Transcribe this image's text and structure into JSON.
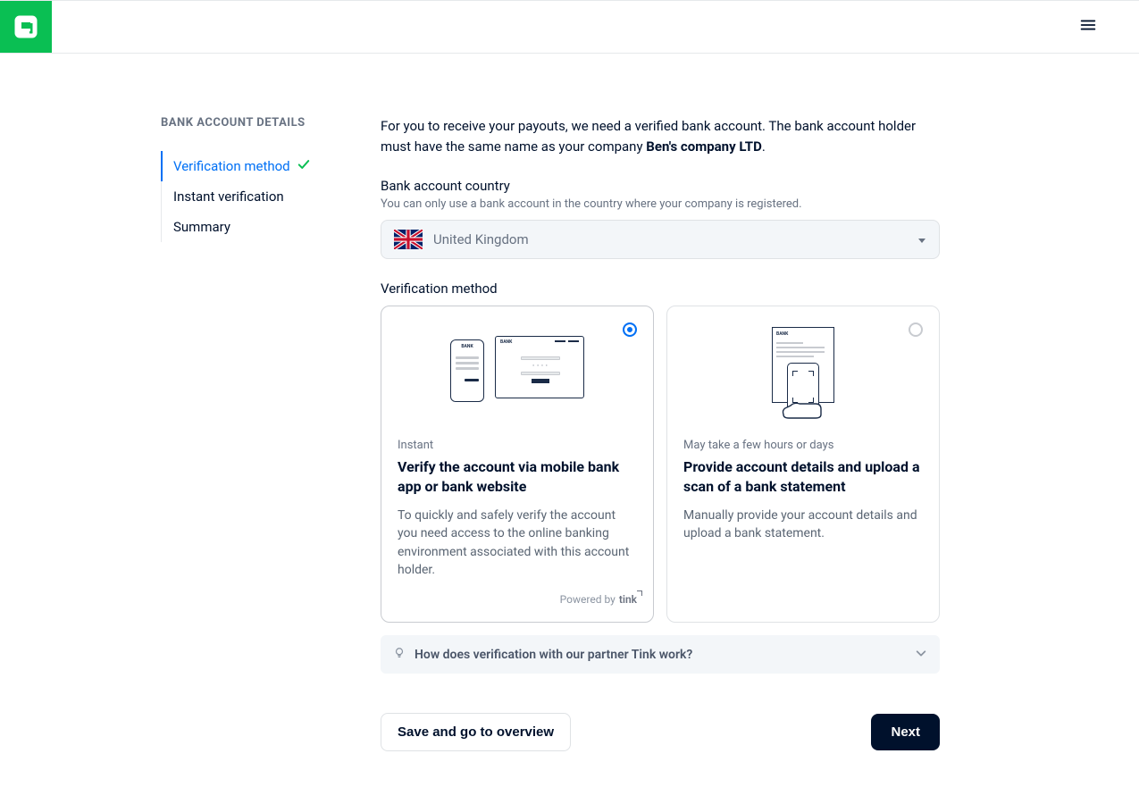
{
  "sidebar": {
    "title": "BANK ACCOUNT DETAILS",
    "items": [
      {
        "label": "Verification method",
        "active": true,
        "completed": true
      },
      {
        "label": "Instant verification",
        "active": false,
        "completed": false
      },
      {
        "label": "Summary",
        "active": false,
        "completed": false
      }
    ]
  },
  "intro": {
    "text_before": "For you to receive your payouts, we need a verified bank account. The bank account holder must have the same name as your company ",
    "company_name": "Ben's company LTD",
    "text_after": "."
  },
  "country": {
    "label": "Bank account country",
    "hint": "You can only use a bank account in the country where your company is registered.",
    "selected": "United Kingdom"
  },
  "method": {
    "label": "Verification method",
    "options": [
      {
        "tag": "Instant",
        "title": "Verify the account via mobile bank app or bank website",
        "desc": "To quickly and safely verify the account you need access to the online banking environment associated with this account holder.",
        "powered_by_label": "Powered by",
        "powered_by_name": "tink",
        "selected": true
      },
      {
        "tag": "May take a few hours or days",
        "title": "Provide account details and upload a scan of a bank statement",
        "desc": "Manually provide your account details and upload a bank statement.",
        "selected": false
      }
    ]
  },
  "accordion": {
    "text": "How does verification with our partner Tink work?"
  },
  "footer": {
    "secondary": "Save and go to overview",
    "primary": "Next"
  }
}
